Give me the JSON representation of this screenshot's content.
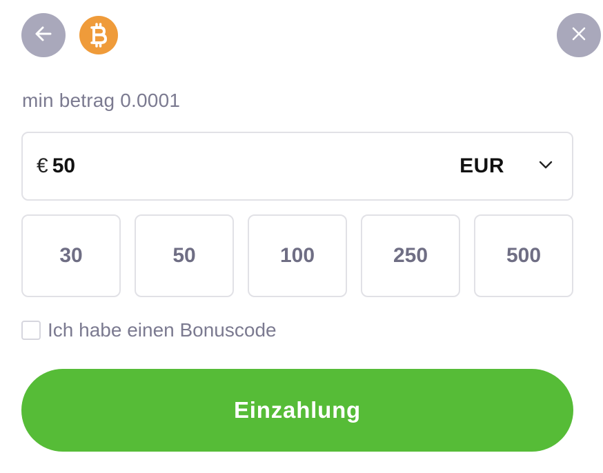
{
  "header": {
    "back_icon": "arrow-left-icon",
    "coin_icon": "bitcoin-icon",
    "close_icon": "close-icon",
    "colors": {
      "icon_button_bg": "#a9a8bb",
      "bitcoin": "#ef9b3a"
    }
  },
  "min_amount": {
    "text": "min betrag 0.0001"
  },
  "amount_input": {
    "currency_symbol": "€",
    "value": "50",
    "currency": "EUR",
    "dropdown_icon": "chevron-down-icon"
  },
  "presets": [
    "30",
    "50",
    "100",
    "250",
    "500"
  ],
  "bonus": {
    "label": "Ich habe einen Bonuscode",
    "checked": false
  },
  "deposit_button": {
    "label": "Einzahlung",
    "color": "#56bc37"
  }
}
